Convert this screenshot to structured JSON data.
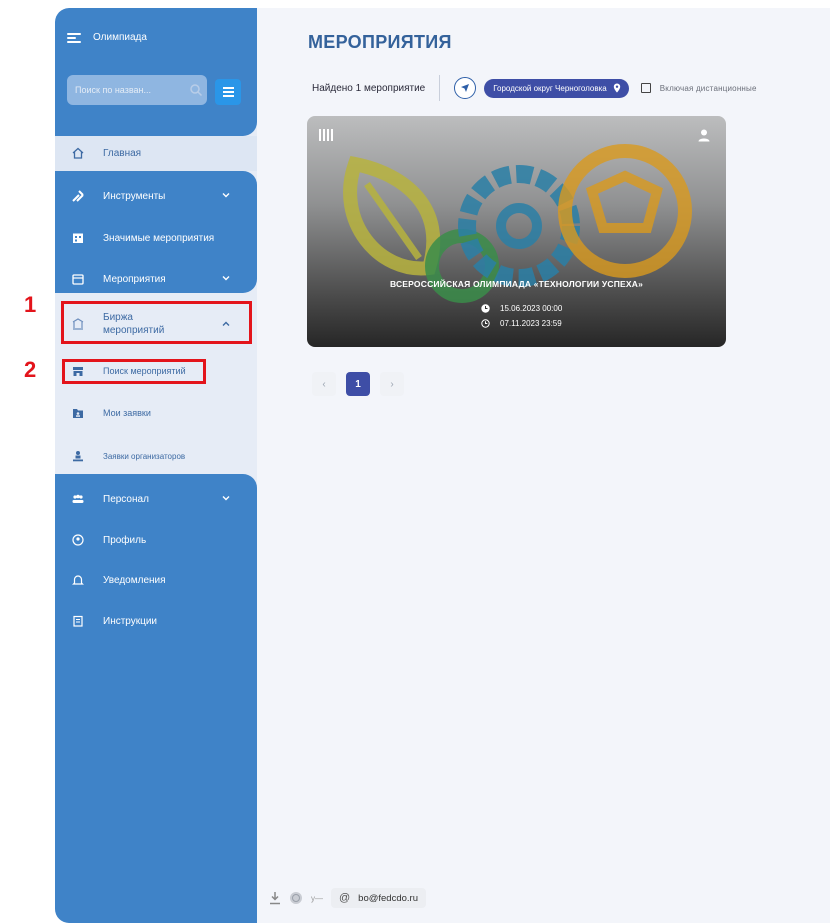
{
  "sidebar": {
    "app_title": "Олимпиада",
    "search_placeholder": "Поиск по назван...",
    "items": [
      {
        "label": "Главная",
        "icon": "home-icon"
      },
      {
        "label": "Инструменты",
        "icon": "tools-icon"
      },
      {
        "label": "Значимые мероприятия",
        "icon": "calendar-grid-icon"
      },
      {
        "label": "Мероприятия",
        "icon": "calendar-icon"
      },
      {
        "label": "Биржа мероприятий",
        "icon": "exchange-icon"
      },
      {
        "label": "Поиск мероприятий",
        "icon": "store-icon"
      },
      {
        "label": "Мои заявки",
        "icon": "folder-user-icon"
      },
      {
        "label": "Заявки организаторов",
        "icon": "organizer-icon"
      },
      {
        "label": "Персонал",
        "icon": "people-icon"
      },
      {
        "label": "Профиль",
        "icon": "profile-icon"
      },
      {
        "label": "Уведомления",
        "icon": "bell-icon"
      },
      {
        "label": "Инструкции",
        "icon": "book-icon"
      }
    ]
  },
  "annotations": {
    "step1": "1",
    "step2": "2"
  },
  "main": {
    "title": "МЕРОПРИЯТИЯ",
    "found_text": "Найдено 1 мероприятие",
    "location_chip": "Городской округ Черноголовка",
    "include_remote_label": "Включая дистанционные",
    "include_remote_checked": false
  },
  "event_card": {
    "title": "ВСЕРОССИЙСКАЯ ОЛИМПИАДА «ТЕХНОЛОГИИ УСПЕХА»",
    "start": "15.06.2023 00:00",
    "end": "07.11.2023 23:59"
  },
  "pagination": {
    "prev": "‹",
    "current": "1",
    "next": "›"
  },
  "footer": {
    "email": "bo@fedcdo.ru",
    "dash_text": "у—"
  },
  "colors": {
    "sidebar_blue": "#3f83c8",
    "accent_indigo": "#3e4ea6",
    "annotation_red": "#e3141b",
    "title_blue": "#34629b"
  }
}
